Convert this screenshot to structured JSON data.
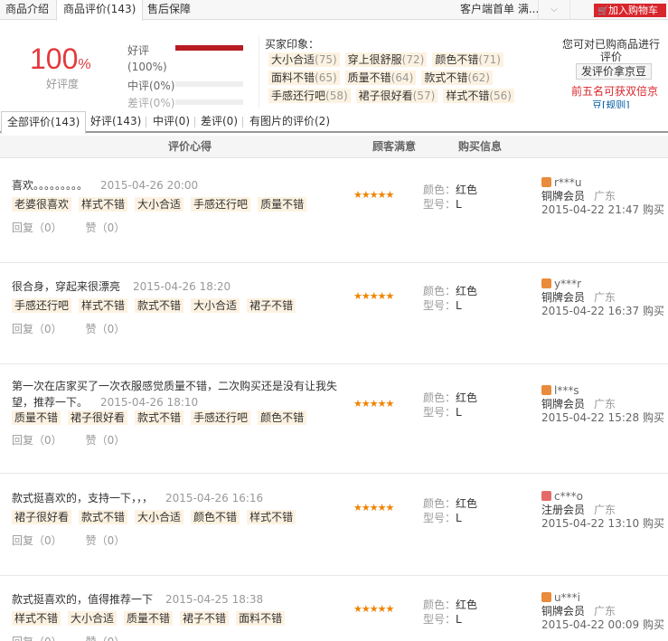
{
  "topbar": {
    "tabs": [
      "商品介绍",
      "商品评价(143)",
      "售后保障"
    ],
    "client_link": "客户端首单 满...",
    "dropdown": "⌵",
    "add_cart": "加入购物车"
  },
  "summary": {
    "percent": "100",
    "percent_sign": "%",
    "percent_label": "好评度",
    "good_label": "好评",
    "good_pct": "(100%)",
    "good_fill": 1.0,
    "mid_label": "中评(0%)",
    "bad_label": "差评(0%)",
    "impressions_title": "买家印象：",
    "impressions": [
      [
        {
          "t": "大小合适",
          "n": "(75)"
        },
        {
          "t": "穿上很舒服",
          "n": "(72)"
        },
        {
          "t": "颜色不错",
          "n": "(71)"
        }
      ],
      [
        {
          "t": "面料不错",
          "n": "(65)"
        },
        {
          "t": "质量不错",
          "n": "(64)"
        },
        {
          "t": "款式不错",
          "n": "(62)"
        }
      ],
      [
        {
          "t": "手感还行吧",
          "n": "(58)"
        },
        {
          "t": "裙子很好看",
          "n": "(57)"
        },
        {
          "t": "样式不错",
          "n": "(56)"
        }
      ]
    ],
    "prompt": "您可对已购商品进行评价",
    "eval_button": "发评价拿京豆",
    "top5": "前五名可获双倍京",
    "top5_rule": "豆[规则]"
  },
  "filter_tabs": [
    "全部评价(143)",
    "好评(143)",
    "中评(0)",
    "差评(0)",
    "有图片的评价(2)"
  ],
  "table_header": {
    "c1": "评价心得",
    "c2": "顾客满意",
    "c3": "购买信息"
  },
  "labels": {
    "color": "颜色：",
    "model": "型号：",
    "reply": "回复（0）",
    "like": "赞（0）",
    "buy_suffix": " 购买"
  },
  "reviews": [
    {
      "content": "喜欢。。。。。。。。。",
      "date": "2015-04-26 20:00",
      "tags": [
        "老婆很喜欢",
        "样式不错",
        "大小合适",
        "手感还行吧",
        "质量不错"
      ],
      "stars": "★★★★★",
      "color": "红色",
      "model": "L",
      "user": "r***u",
      "level": "铜牌会员",
      "loc": "广东",
      "time": "2015-04-22 21:47"
    },
    {
      "content": "很合身，穿起来很漂亮",
      "date": "2015-04-26 18:20",
      "tags": [
        "手感还行吧",
        "样式不错",
        "款式不错",
        "大小合适",
        "裙子不错"
      ],
      "stars": "★★★★★",
      "color": "红色",
      "model": "L",
      "user": "y***r",
      "level": "铜牌会员",
      "loc": "广东",
      "time": "2015-04-22 16:37"
    },
    {
      "content": "第一次在店家买了一次衣服感觉质量不错，二次购买还是没有让我失望，推荐一下。",
      "date": "2015-04-26 18:10",
      "tags": [
        "质量不错",
        "裙子很好看",
        "款式不错",
        "手感还行吧",
        "颜色不错"
      ],
      "stars": "★★★★★",
      "color": "红色",
      "model": "L",
      "user": "l***s",
      "level": "铜牌会员",
      "loc": "广东",
      "time": "2015-04-22 15:28"
    },
    {
      "content": "款式挺喜欢的，支持一下，，，",
      "date": "2015-04-26 16:16",
      "tags": [
        "裙子很好看",
        "款式不错",
        "大小合适",
        "颜色不错",
        "样式不错"
      ],
      "stars": "★★★★★",
      "color": "红色",
      "model": "L",
      "user": "c***o",
      "level": "注册会员",
      "loc": "广东",
      "time": "2015-04-22 13:10"
    },
    {
      "content": "款式挺喜欢的，值得推荐一下",
      "date": "2015-04-25 18:38",
      "tags": [
        "样式不错",
        "大小合适",
        "质量不错",
        "裙子不错",
        "面料不错"
      ],
      "stars": "★★★★★",
      "color": "红色",
      "model": "L",
      "user": "u***i",
      "level": "铜牌会员",
      "loc": "广东",
      "time": "2015-04-22 00:09"
    }
  ],
  "colors": {
    "accent": "#e4393c",
    "tag_bg": "#fdf2e1",
    "star": "#f08300"
  }
}
